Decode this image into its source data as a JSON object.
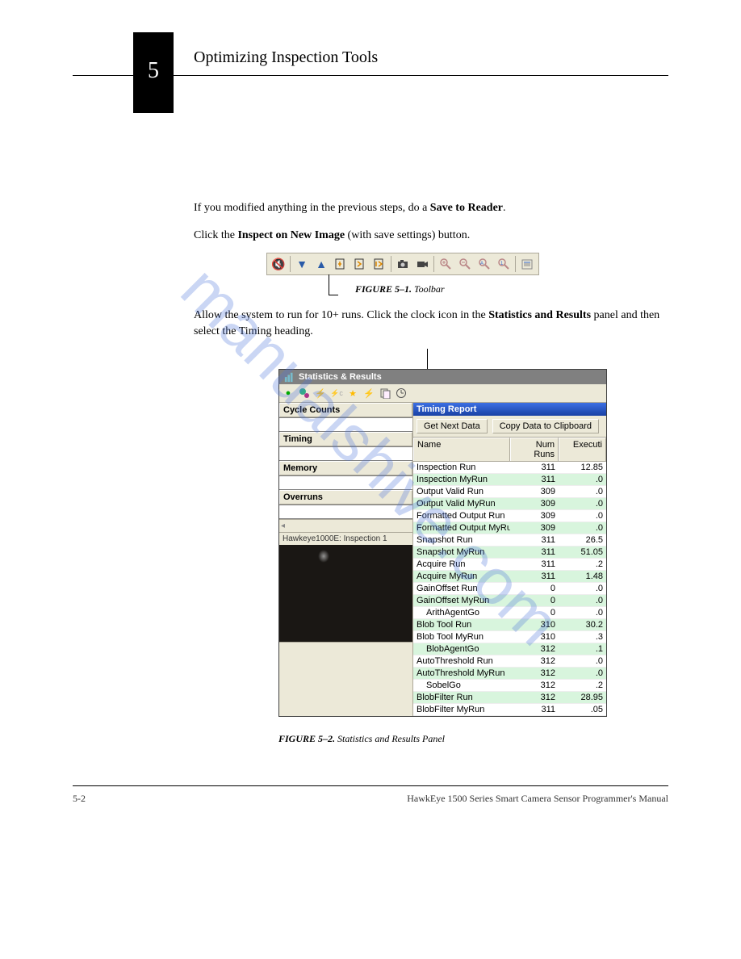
{
  "header": {
    "chapter_num": "5",
    "chapter_title": "Optimizing Inspection Tools"
  },
  "p1": "If you modified anything in the previous steps, do a ",
  "p1_bold": "Save to Reader",
  "p1_end": ".",
  "p2": "Click the ",
  "p2_bold": "Inspect on New Image",
  "p2_end": " (with save settings) button.",
  "toolbar": {
    "icons": [
      "mute",
      "tri-down",
      "tri-up",
      "frame-step",
      "frame-next",
      "frame-out",
      "camera",
      "camcorder",
      "zoom-in",
      "zoom-out",
      "zoom-auto",
      "zoom-info",
      "props"
    ]
  },
  "fig1_label": "FIGURE 5–1. ",
  "fig1_text": "Toolbar",
  "p3": "Allow the system to run for 10+ runs. Click the clock icon in the ",
  "p3_bold": "Statistics and Results",
  "p3_end": " panel and then select the Timing heading.",
  "stat_window": {
    "title": "Statistics & Results",
    "categories": [
      "Cycle Counts",
      "Timing",
      "Memory",
      "Overruns"
    ],
    "status": "Hawkeye1000E: Inspection 1",
    "timing_title": "Timing Report",
    "btn_get": "Get Next Data",
    "btn_copy": "Copy Data to Clipboard",
    "col_name": "Name",
    "col_runs": "Num Runs",
    "col_exec": "Executi"
  },
  "timing_rows": [
    {
      "n": "Inspection Run",
      "r": "311",
      "e": "12.85",
      "hl": false
    },
    {
      "n": "Inspection MyRun",
      "r": "311",
      "e": ".0",
      "hl": true
    },
    {
      "n": "Output Valid Run",
      "r": "309",
      "e": ".0",
      "hl": false
    },
    {
      "n": "Output Valid MyRun",
      "r": "309",
      "e": ".0",
      "hl": true
    },
    {
      "n": "Formatted Output Run",
      "r": "309",
      "e": ".0",
      "hl": false
    },
    {
      "n": "Formatted Output MyRu",
      "r": "309",
      "e": ".0",
      "hl": true
    },
    {
      "n": "Snapshot Run",
      "r": "311",
      "e": "26.5",
      "hl": false
    },
    {
      "n": "Snapshot MyRun",
      "r": "311",
      "e": "51.05",
      "hl": true
    },
    {
      "n": "Acquire Run",
      "r": "311",
      "e": ".2",
      "hl": false
    },
    {
      "n": "Acquire MyRun",
      "r": "311",
      "e": "1.48",
      "hl": true
    },
    {
      "n": "GainOffset Run",
      "r": "0",
      "e": ".0",
      "hl": false
    },
    {
      "n": "GainOffset MyRun",
      "r": "0",
      "e": ".0",
      "hl": true
    },
    {
      "n": "ArithAgentGo",
      "r": "0",
      "e": ".0",
      "hl": false,
      "indent": true
    },
    {
      "n": "Blob Tool Run",
      "r": "310",
      "e": "30.2",
      "hl": true
    },
    {
      "n": "Blob Tool MyRun",
      "r": "310",
      "e": ".3",
      "hl": false
    },
    {
      "n": "BlobAgentGo",
      "r": "312",
      "e": ".1",
      "hl": true,
      "indent": true
    },
    {
      "n": "AutoThreshold Run",
      "r": "312",
      "e": ".0",
      "hl": false
    },
    {
      "n": "AutoThreshold MyRun",
      "r": "312",
      "e": ".0",
      "hl": true
    },
    {
      "n": "SobelGo",
      "r": "312",
      "e": ".2",
      "hl": false,
      "indent": true
    },
    {
      "n": "BlobFilter Run",
      "r": "312",
      "e": "28.95",
      "hl": true
    },
    {
      "n": "BlobFilter MyRun",
      "r": "311",
      "e": ".05",
      "hl": false
    }
  ],
  "fig2_label": "FIGURE 5–2. ",
  "fig2_text": "Statistics and Results Panel",
  "footer_left": "5-2",
  "footer_right": "HawkEye 1500 Series Smart Camera Sensor Programmer's Manual"
}
